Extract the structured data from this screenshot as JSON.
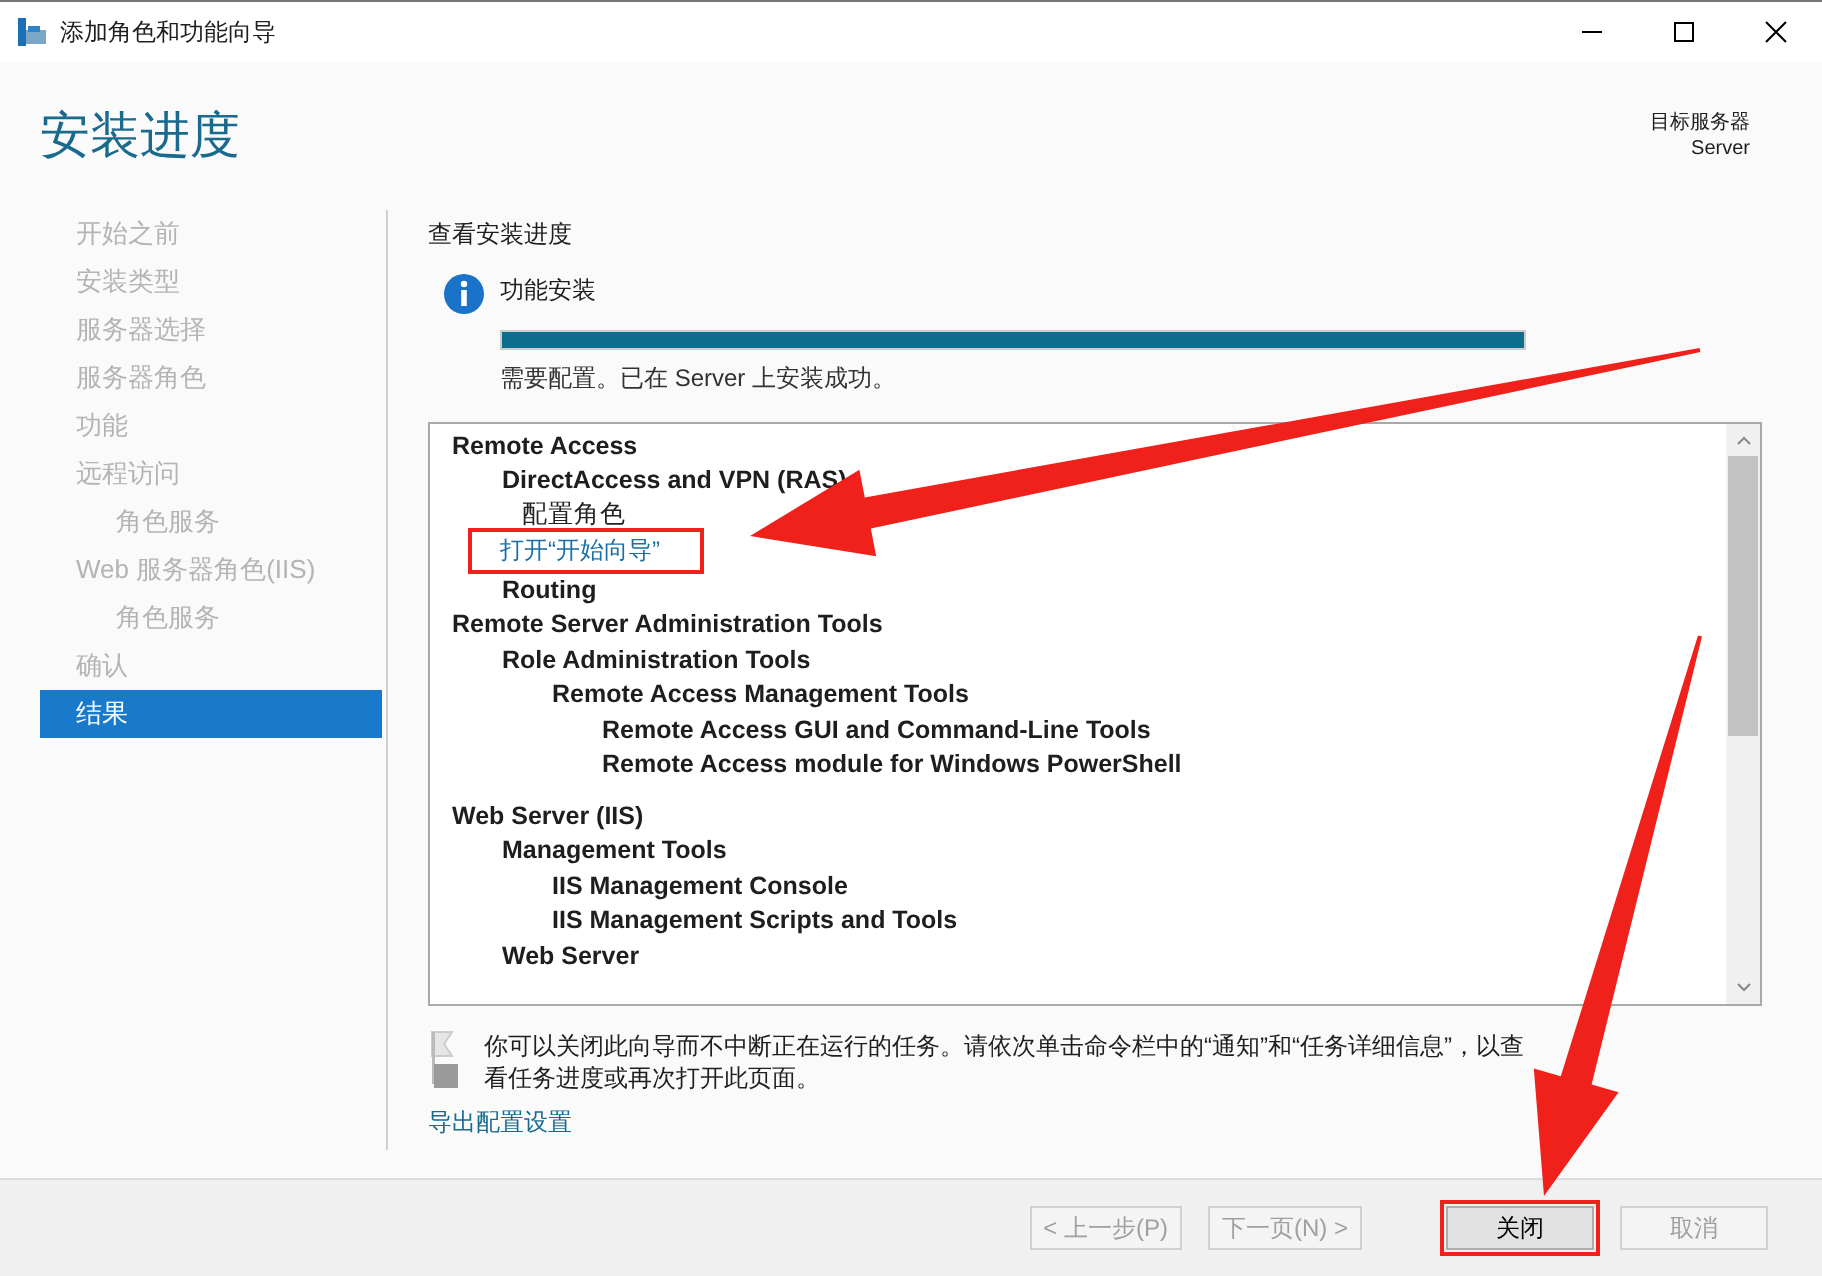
{
  "window": {
    "title": "添加角色和功能向导"
  },
  "header": {
    "title": "安装进度",
    "target_label": "目标服务器",
    "target_server": "Server"
  },
  "sidebar": {
    "items": [
      {
        "label": "开始之前",
        "selected": false
      },
      {
        "label": "安装类型",
        "selected": false
      },
      {
        "label": "服务器选择",
        "selected": false
      },
      {
        "label": "服务器角色",
        "selected": false
      },
      {
        "label": "功能",
        "selected": false
      },
      {
        "label": "远程访问",
        "selected": false,
        "children": [
          {
            "label": "角色服务",
            "selected": false
          }
        ]
      },
      {
        "label": "Web 服务器角色(IIS)",
        "selected": false,
        "children": [
          {
            "label": "角色服务",
            "selected": false
          }
        ]
      },
      {
        "label": "确认",
        "selected": false
      },
      {
        "label": "结果",
        "selected": true
      }
    ]
  },
  "content": {
    "heading": "查看安装进度",
    "status_title": "功能安装",
    "progress": {
      "level": 1.0
    },
    "status_text": "需要配置。已在 Server 上安装成功。",
    "results": [
      {
        "kind": "heading",
        "label": "Remote Access",
        "children": [
          {
            "kind": "heading",
            "label": "DirectAccess and VPN (RAS)",
            "children": [
              {
                "kind": "note",
                "label": "配置角色"
              },
              {
                "kind": "link",
                "label": "打开“开始向导”",
                "highlighted": true
              }
            ]
          },
          {
            "kind": "heading",
            "label": "Routing"
          }
        ]
      },
      {
        "kind": "heading",
        "label": "Remote Server Administration Tools",
        "children": [
          {
            "kind": "heading",
            "label": "Role Administration Tools",
            "children": [
              {
                "kind": "heading",
                "label": "Remote Access Management Tools",
                "children": [
                  {
                    "kind": "heading",
                    "label": "Remote Access GUI and Command-Line Tools"
                  },
                  {
                    "kind": "heading",
                    "label": "Remote Access module for Windows PowerShell"
                  }
                ]
              }
            ]
          }
        ]
      },
      {
        "kind": "spacer"
      },
      {
        "kind": "heading",
        "label": "Web Server (IIS)",
        "children": [
          {
            "kind": "heading",
            "label": "Management Tools",
            "children": [
              {
                "kind": "heading",
                "label": "IIS Management Console"
              },
              {
                "kind": "heading",
                "label": "IIS Management Scripts and Tools"
              }
            ]
          },
          {
            "kind": "heading",
            "label": "Web Server"
          }
        ]
      }
    ],
    "notice": "你可以关闭此向导而不中断正在运行的任务。请依次单击命令栏中的“通知”和“任务详细信息”，以查看任务进度或再次打开此页面。",
    "export_link": "导出配置设置"
  },
  "buttons": [
    {
      "label": "< 上一步(P)",
      "disabled": true,
      "highlighted": false
    },
    {
      "label": "下一页(N) >",
      "disabled": true,
      "highlighted": false
    },
    {
      "label": "关闭",
      "disabled": false,
      "highlighted": true
    },
    {
      "label": "取消",
      "disabled": true,
      "highlighted": false
    }
  ]
}
